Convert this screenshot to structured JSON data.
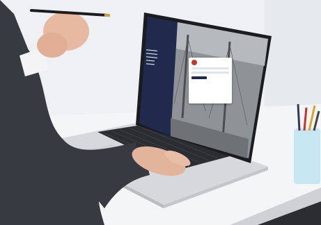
{
  "scene": {
    "description_colors": {
      "background": "#f1f2f4",
      "laptop_body": "#d9dbdf",
      "screen_left_panel": "#1f2a4d",
      "suit": "#3a3c44"
    }
  }
}
